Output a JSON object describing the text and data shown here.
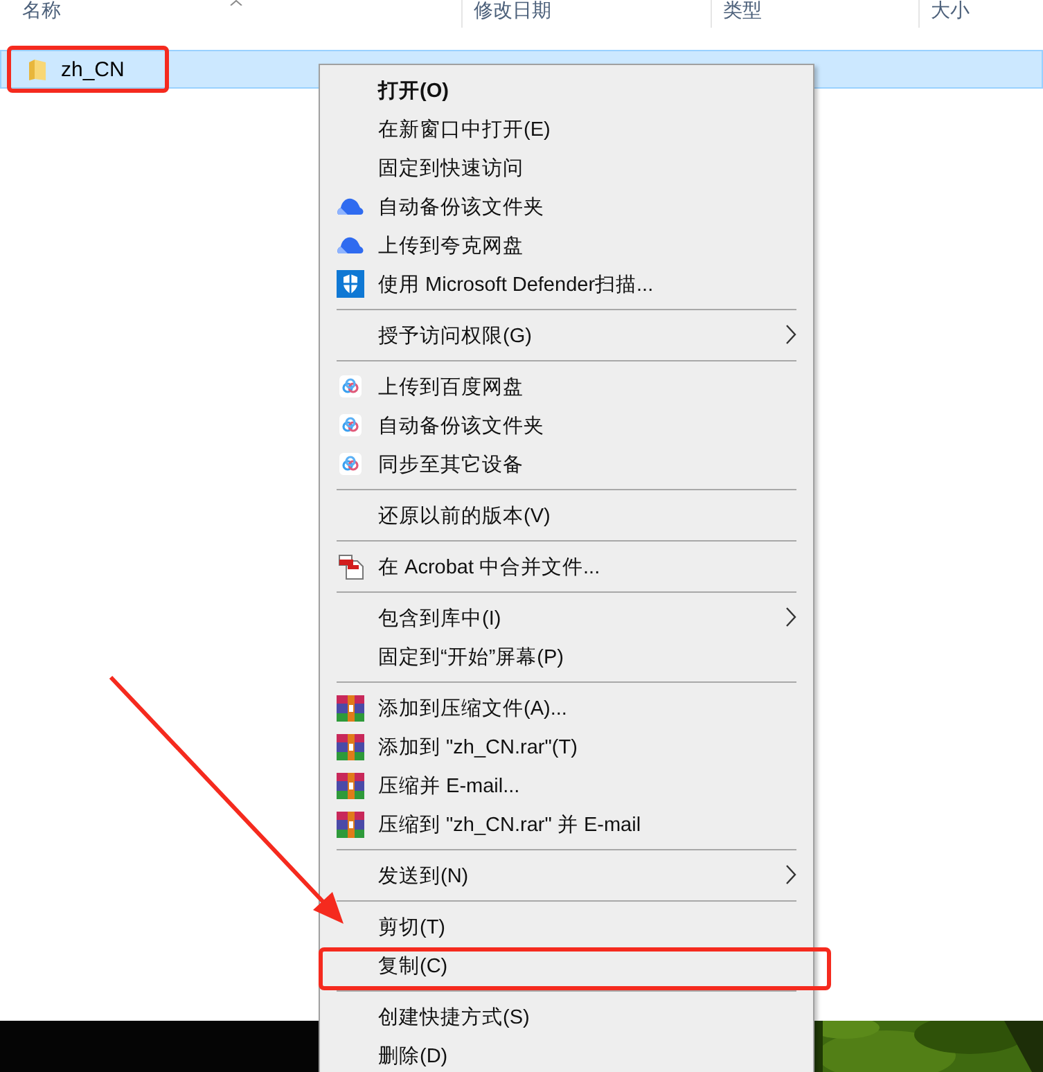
{
  "columns": [
    "名称",
    "修改日期",
    "类型",
    "大小"
  ],
  "file": {
    "name": "zh_CN",
    "selected": true,
    "marked": true
  },
  "menu": [
    [
      {
        "label": "打开(O)",
        "bold": true,
        "kind": "plain",
        "submenu": false,
        "marked": false
      },
      {
        "label": "在新窗口中打开(E)",
        "bold": false,
        "kind": "plain",
        "submenu": false,
        "marked": false
      },
      {
        "label": "固定到快速访问",
        "bold": false,
        "kind": "plain",
        "submenu": false,
        "marked": false
      },
      {
        "label": "自动备份该文件夹",
        "bold": false,
        "kind": "cloud",
        "submenu": false,
        "marked": false
      },
      {
        "label": "上传到夸克网盘",
        "bold": false,
        "kind": "cloud",
        "submenu": false,
        "marked": false
      },
      {
        "label": "使用 Microsoft Defender扫描...",
        "bold": false,
        "kind": "shield",
        "submenu": false,
        "marked": false
      }
    ],
    [
      {
        "label": "授予访问权限(G)",
        "bold": false,
        "kind": "plain",
        "submenu": true,
        "marked": false
      }
    ],
    [
      {
        "label": "上传到百度网盘",
        "bold": false,
        "kind": "rings",
        "submenu": false,
        "marked": false
      },
      {
        "label": "自动备份该文件夹",
        "bold": false,
        "kind": "rings",
        "submenu": false,
        "marked": false
      },
      {
        "label": "同步至其它设备",
        "bold": false,
        "kind": "rings",
        "submenu": false,
        "marked": false
      }
    ],
    [
      {
        "label": "还原以前的版本(V)",
        "bold": false,
        "kind": "plain",
        "submenu": false,
        "marked": false
      }
    ],
    [
      {
        "label": "在 Acrobat 中合并文件...",
        "bold": false,
        "kind": "documents",
        "submenu": false,
        "marked": false
      }
    ],
    [
      {
        "label": "包含到库中(I)",
        "bold": false,
        "kind": "plain",
        "submenu": true,
        "marked": false
      },
      {
        "label": "固定到“开始”屏幕(P)",
        "bold": false,
        "kind": "plain",
        "submenu": false,
        "marked": false
      }
    ],
    [
      {
        "label": "添加到压缩文件(A)...",
        "bold": false,
        "kind": "archive",
        "submenu": false,
        "marked": false
      },
      {
        "label": "添加到 \"zh_CN.rar\"(T)",
        "bold": false,
        "kind": "archive",
        "submenu": false,
        "marked": false
      },
      {
        "label": "压缩并 E-mail...",
        "bold": false,
        "kind": "archive",
        "submenu": false,
        "marked": false
      },
      {
        "label": "压缩到 \"zh_CN.rar\" 并 E-mail",
        "bold": false,
        "kind": "archive",
        "submenu": false,
        "marked": false
      }
    ],
    [
      {
        "label": "发送到(N)",
        "bold": false,
        "kind": "plain",
        "submenu": true,
        "marked": false
      }
    ],
    [
      {
        "label": "剪切(T)",
        "bold": false,
        "kind": "plain",
        "submenu": false,
        "marked": false
      },
      {
        "label": "复制(C)",
        "bold": false,
        "kind": "plain",
        "submenu": false,
        "marked": true
      }
    ],
    [
      {
        "label": "创建快捷方式(S)",
        "bold": false,
        "kind": "plain",
        "submenu": false,
        "marked": false
      },
      {
        "label": "删除(D)",
        "bold": false,
        "kind": "plain",
        "submenu": false,
        "marked": false
      }
    ]
  ],
  "wallpaper": {
    "kind": "picture"
  }
}
